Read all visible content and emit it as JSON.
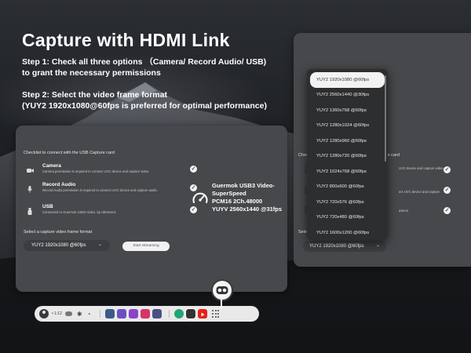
{
  "headline": "Capture with HDMI Link",
  "step1": {
    "line1": "Step 1: Check all three options （Camera/ Record Audio/ USB)",
    "line2": "to grant the necessary permissions"
  },
  "step2": {
    "line1": "Step 2: Select the video frame format",
    "line2": "(YUY2 1920x1080@60fps is preferred for optimal performance)"
  },
  "window_left": {
    "checklist_title": "Checklist to connect with the USB Capture card",
    "options": [
      {
        "name": "Camera",
        "desc": "Camera permission is required to connect UVC device and capture video.",
        "icon": "camera-icon",
        "checked": true
      },
      {
        "name": "Record Audio",
        "desc": "Record Audio permission is required to connect UVC device and capture audio.",
        "icon": "microphone-icon",
        "checked": true
      },
      {
        "name": "USB",
        "desc": "Connected to Guermok USB3 Video. by UltraSemi",
        "icon": "usb-icon",
        "checked": true
      }
    ],
    "format_label": "Select a capture video frame format",
    "format_selected": "YUY2 1920x1080 @60fps",
    "start_button": "Start Streaming",
    "device_info": {
      "line1": "Guermok USB3 Video-",
      "line2": "SuperSpeed",
      "line3": "PCM16 2Ch.48000",
      "line4": "YUYV 2560x1440 @31fps"
    }
  },
  "window_right": {
    "checklist_title_partial": "Check",
    "checklist_title_tail": "e card",
    "desc_camera": "UVC device and capture video.",
    "desc_audio": "ect UVC device and capture",
    "desc_usb": "aSemi",
    "format_label_partial": "Sele",
    "format_selected": "YUY2 1920x1080 @60fps",
    "dropdown_options": [
      "YUY2 1920x1080 @60fps",
      "YUY2 2560x1440 @30fps",
      "YUY2 1360x768 @60fps",
      "YUY2 1280x1024 @60fps",
      "YUY2 1280x960 @60fps",
      "YUY2 1280x720 @60fps",
      "YUY2 1024x768 @60fps",
      "YUY2 800x600 @60fps",
      "YUY2 720x576 @60fps",
      "YUY2 720x480 @60fps",
      "YUY2 1600x1200 @60fps"
    ],
    "dropdown_selected_index": 0
  },
  "taskbar": {
    "time_text": "• 1:12",
    "apps": [
      "store-app",
      "files-app",
      "people-app",
      "photo-app",
      "game-app",
      "hdmi-link-app",
      "media-app",
      "youtube-app"
    ]
  },
  "colors": {
    "window_bg": "#46484b",
    "dropdown_bg": "#2d2e30",
    "taskbar_bg": "#e9e9ea",
    "youtube_red": "#e62117"
  }
}
